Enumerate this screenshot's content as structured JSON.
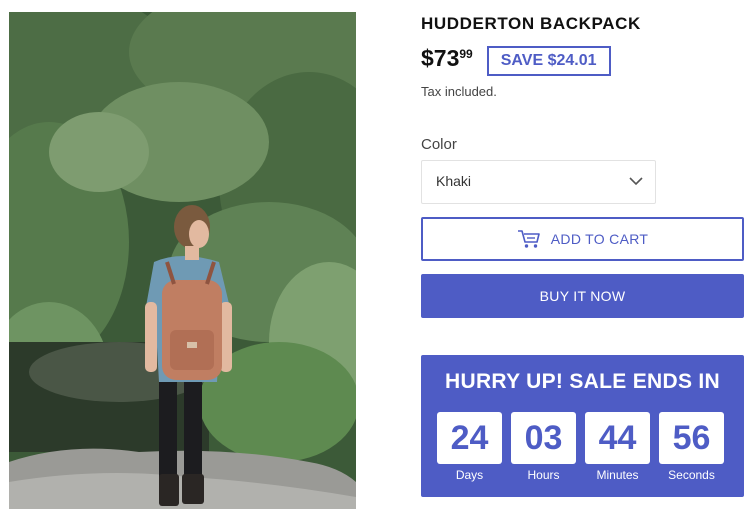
{
  "product": {
    "title": "HUDDERTON BACKPACK",
    "price_main": "$73",
    "price_cents": "99",
    "save_badge": "SAVE $24.01",
    "tax_note": "Tax included."
  },
  "variant": {
    "label": "Color",
    "selected": "Khaki"
  },
  "actions": {
    "add_to_cart": "ADD TO CART",
    "buy_now": "BUY IT NOW"
  },
  "countdown": {
    "title": "HURRY UP! SALE ENDS IN",
    "units": [
      {
        "value": "24",
        "label": "Days"
      },
      {
        "value": "03",
        "label": "Hours"
      },
      {
        "value": "44",
        "label": "Minutes"
      },
      {
        "value": "56",
        "label": "Seconds"
      }
    ]
  },
  "colors": {
    "accent": "#4e5cc5",
    "foliage_dark": "#2f4a2c",
    "foliage_light": "#6f8f62",
    "backpack": "#c07e62"
  },
  "icons": {
    "cart": "cart-icon",
    "select": "chevron-down-icon"
  }
}
